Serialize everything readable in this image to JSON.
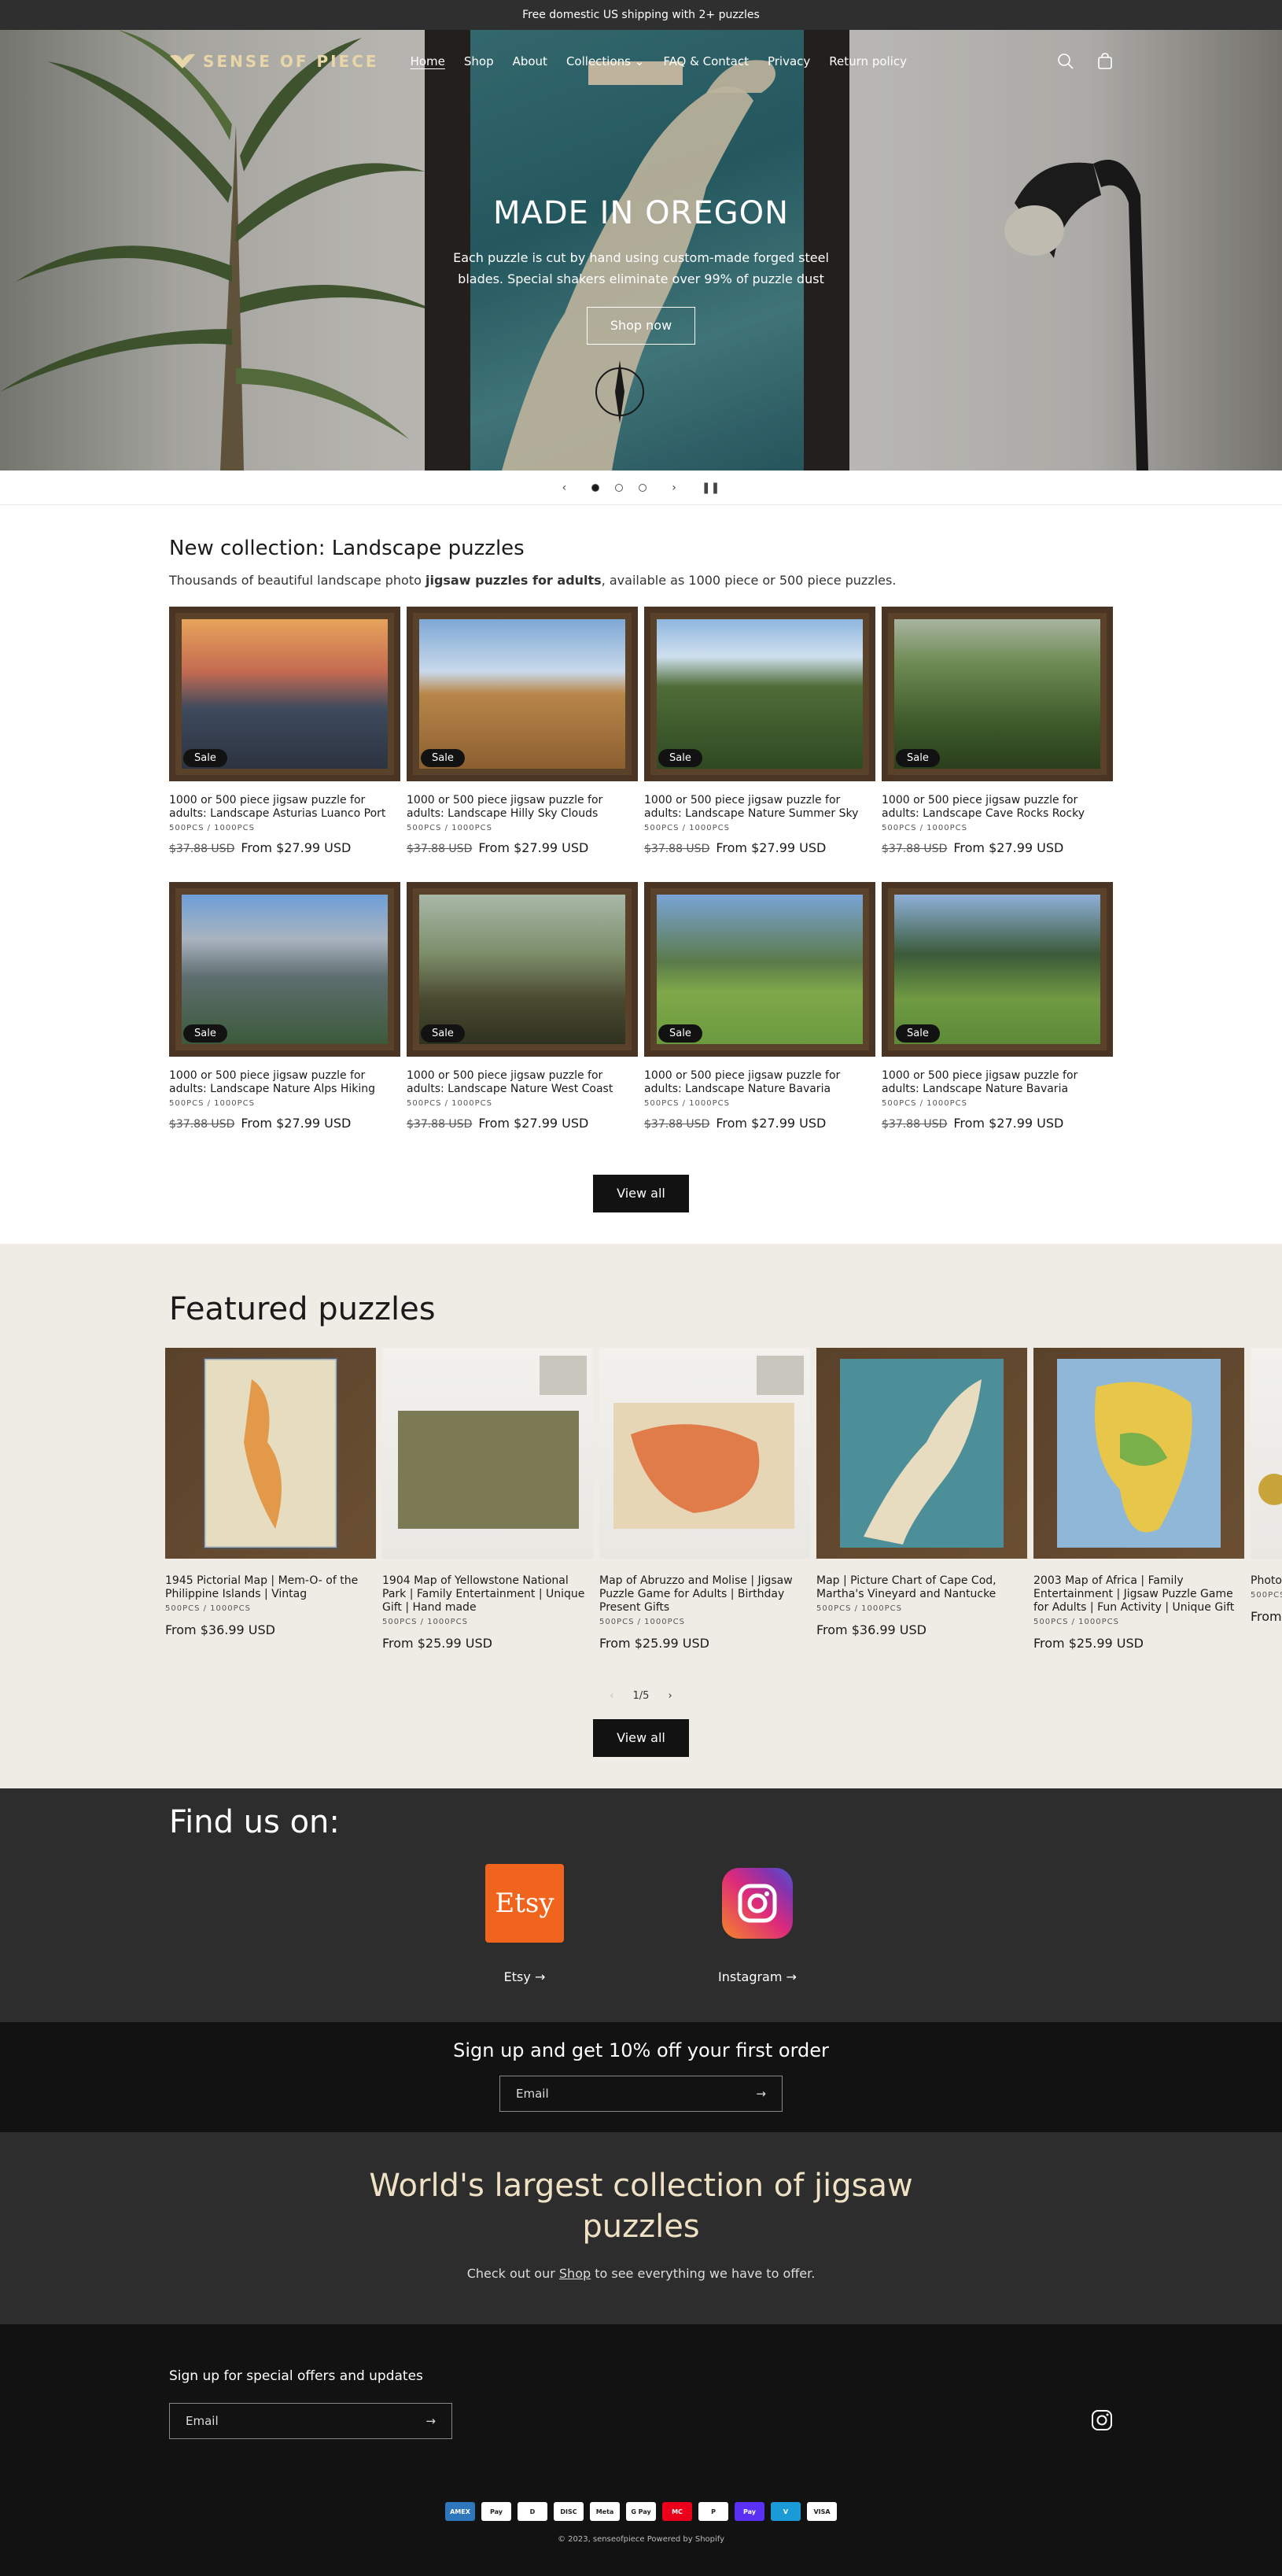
{
  "announcement": "Free domestic US shipping with 2+ puzzles",
  "header": {
    "logo": "SENSE OF PIECE",
    "nav": [
      "Home",
      "Shop",
      "About",
      "Collections ⌄",
      "FAQ & Contact",
      "Privacy",
      "Return policy"
    ]
  },
  "hero": {
    "title": "MADE IN OREGON",
    "text": "Each puzzle is cut by hand using custom-made forged steel blades. Special shakers eliminate over 99% of puzzle dust",
    "button": "Shop now"
  },
  "collection": {
    "title": "New collection: Landscape puzzles",
    "desc_pre": "Thousands of beautiful landscape photo ",
    "desc_bold": "jigsaw puzzles for adults",
    "desc_post": ", available as 1000 piece or 500 piece puzzles.",
    "badge": "Sale",
    "variant": "500PCS / 1000PCS",
    "old_price": "$37.88 USD",
    "price": "From $27.99 USD",
    "products": [
      "1000 or 500 piece jigsaw puzzle for adults: Landscape Asturias Luanco Port",
      "1000 or 500 piece jigsaw puzzle for adults: Landscape Hilly Sky Clouds",
      "1000 or 500 piece jigsaw puzzle for adults: Landscape Nature Summer Sky",
      "1000 or 500 piece jigsaw puzzle for adults: Landscape Cave Rocks Rocky",
      "1000 or 500 piece jigsaw puzzle for adults: Landscape Nature Alps Hiking",
      "1000 or 500 piece jigsaw puzzle for adults: Landscape Nature West Coast",
      "1000 or 500 piece jigsaw puzzle for adults: Landscape Nature Bavaria",
      "1000 or 500 piece jigsaw puzzle for adults: Landscape Nature Bavaria"
    ],
    "view_all": "View all"
  },
  "featured": {
    "title": "Featured puzzles",
    "items": [
      {
        "title": "1945 Pictorial Map | Mem-O- of the Philippine Islands | Vintag",
        "price": "From $36.99 USD"
      },
      {
        "title": "1904 Map of Yellowstone National Park | Family Entertainment | Unique Gift | Hand made",
        "price": "From $25.99 USD"
      },
      {
        "title": "Map of Abruzzo and Molise | Jigsaw Puzzle Game for Adults | Birthday Present Gifts",
        "price": "From $25.99 USD"
      },
      {
        "title": "Map | Picture Chart of Cape Cod, Martha's Vineyard and Nantucke",
        "price": "From $36.99 USD"
      },
      {
        "title": "2003 Map of Africa | Family Entertainment | Jigsaw Puzzle Game for Adults | Fun Activity | Unique Gift",
        "price": "From $25.99 USD"
      },
      {
        "title": "Photo Under Englan",
        "price": "From"
      }
    ],
    "variant": "500PCS / 1000PCS",
    "pager": "1/5",
    "view_all": "View all"
  },
  "findus": {
    "title": "Find us on:",
    "etsy_logo": "Etsy",
    "etsy": "Etsy",
    "instagram": "Instagram"
  },
  "signup": {
    "title": "Sign up and get 10% off your first order",
    "placeholder": "Email"
  },
  "largest": {
    "title": "World's largest collection of jigsaw puzzles",
    "text_pre": "Check out our ",
    "link": "Shop",
    "text_post": " to see everything we have to offer."
  },
  "footer": {
    "title": "Sign up for special offers and updates",
    "placeholder": "Email",
    "payments": [
      "AMEX",
      "Pay",
      "D",
      "DISC",
      "Meta",
      "G Pay",
      "MC",
      "P",
      "Pay",
      "V",
      "VISA"
    ],
    "copyright": "© 2023, senseofpiece Powered by Shopify"
  }
}
